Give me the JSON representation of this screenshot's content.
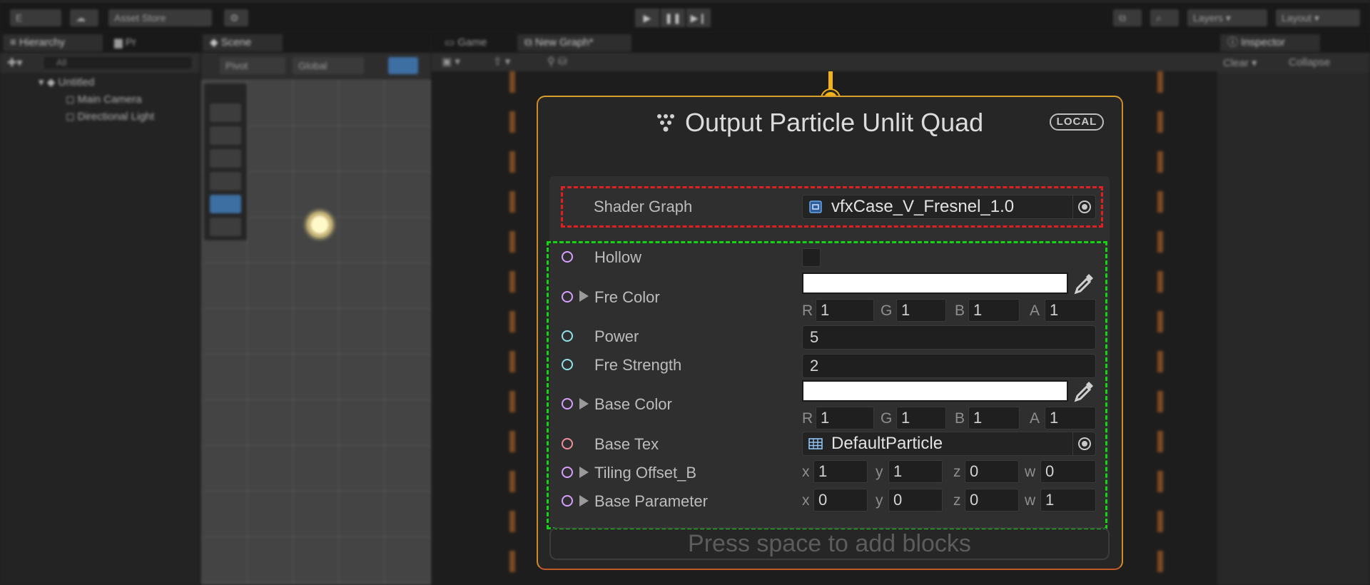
{
  "toolbar": {
    "account_label": "E",
    "asset_store_label": "Asset Store",
    "layers_label": "Layers",
    "layout_label": "Layout"
  },
  "hierarchy": {
    "tab_label": "Hierarchy",
    "project_tab_label": "Pr",
    "search_placeholder": "All",
    "scene_name": "Untitled",
    "items": [
      "Main Camera",
      "Directional Light"
    ]
  },
  "scene_view": {
    "tab_label": "Scene",
    "pivot_label": "Pivot",
    "global_label": "Global"
  },
  "graph": {
    "tabs": [
      "Game",
      "New Graph*"
    ]
  },
  "inspector": {
    "tab_label": "Inspector",
    "clear_label": "Clear",
    "collapse_label": "Collapse"
  },
  "node": {
    "title": "Output Particle Unlit Quad",
    "badge": "LOCAL",
    "shader_graph": {
      "label": "Shader Graph",
      "value": "vfxCase_V_Fresnel_1.0"
    },
    "hollow": {
      "label": "Hollow",
      "checked": false
    },
    "fre_color": {
      "label": "Fre Color",
      "r": "1",
      "g": "1",
      "b": "1",
      "a": "1",
      "swatch": "#ffffff"
    },
    "power": {
      "label": "Power",
      "value": "5"
    },
    "fre_strength": {
      "label": "Fre Strength",
      "value": "2"
    },
    "base_color": {
      "label": "Base Color",
      "r": "1",
      "g": "1",
      "b": "1",
      "a": "1",
      "swatch": "#ffffff"
    },
    "base_tex": {
      "label": "Base Tex",
      "value": "DefaultParticle"
    },
    "tiling_offset": {
      "label": "Tiling Offset_B",
      "x": "1",
      "y": "1",
      "z": "0",
      "w": "0"
    },
    "base_parameter": {
      "label": "Base Parameter",
      "x": "0",
      "y": "0",
      "z": "0",
      "w": "1"
    },
    "component_letters": {
      "r": "R",
      "g": "G",
      "b": "B",
      "a": "A",
      "x": "x",
      "y": "y",
      "z": "z",
      "w": "w"
    },
    "add_blocks_hint": "Press space to add blocks"
  },
  "colors": {
    "node_border": "#d8a02a",
    "connector": "#f2b318",
    "highlight_red": "#e02020",
    "highlight_green": "#14d414",
    "port_purple": "#d7a0ff",
    "port_cyan": "#8fe3ea",
    "port_pink": "#f08f9a"
  }
}
